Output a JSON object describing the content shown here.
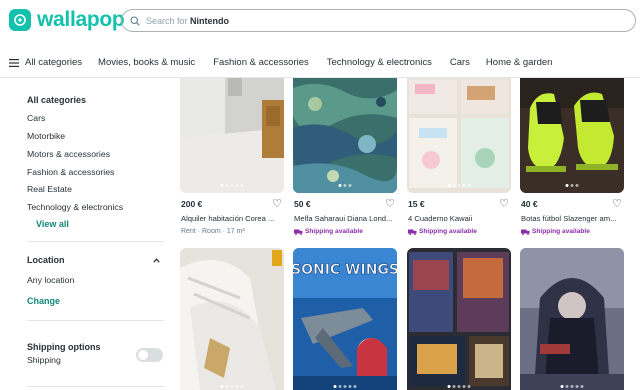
{
  "app": {
    "name": "wallapop",
    "brand_color": "#13c1ac"
  },
  "search": {
    "placeholder_prefix": "Search for",
    "placeholder_term": "Nintendo"
  },
  "catnav": {
    "all_categories": "All categories",
    "items": [
      "Movies, books & music",
      "Fashion & accessories",
      "Technology & electronics",
      "Cars",
      "Home & garden"
    ]
  },
  "sidebar": {
    "categories_title": "All categories",
    "categories": [
      "Cars",
      "Motorbike",
      "Motors & accessories",
      "Fashion & accessories",
      "Real Estate",
      "Technology & electronics"
    ],
    "view_all": "View all",
    "location_title": "Location",
    "location_value": "Any location",
    "location_change": "Change",
    "shipping_title": "Shipping options",
    "shipping_label": "Shipping",
    "shipping_enabled": false
  },
  "products": [
    {
      "price": "200 €",
      "title": "Alquiler habitación Corea ...",
      "meta": "Rent · Room · 17 m²",
      "shipping": ""
    },
    {
      "price": "50 €",
      "title": "Melfa Saharaui Diana Lond...",
      "meta": "",
      "shipping": "Shipping available"
    },
    {
      "price": "15 €",
      "title": "4 Cuaderno Kawaii",
      "meta": "",
      "shipping": "Shipping available"
    },
    {
      "price": "40 €",
      "title": "Botas fútbol Slazenger am...",
      "meta": "",
      "shipping": "Shipping available"
    },
    {
      "price": "",
      "title": "",
      "meta": "",
      "shipping": ""
    },
    {
      "price": "",
      "title": "",
      "meta": "",
      "shipping": ""
    },
    {
      "price": "",
      "title": "",
      "meta": "",
      "shipping": ""
    },
    {
      "price": "",
      "title": "",
      "meta": "",
      "shipping": ""
    }
  ],
  "images": {
    "p1": "room-photo",
    "p2": "patterned-fabric-photo",
    "p3": "notebooks-photo",
    "p4": "football-boots-photo",
    "p5": "white-sneakers-photo",
    "p6": "sonic-wings-box-photo",
    "p7": "game-boxes-photo",
    "p8": "castlevania-poster-photo",
    "p6_text": "SONIC WINGS"
  }
}
